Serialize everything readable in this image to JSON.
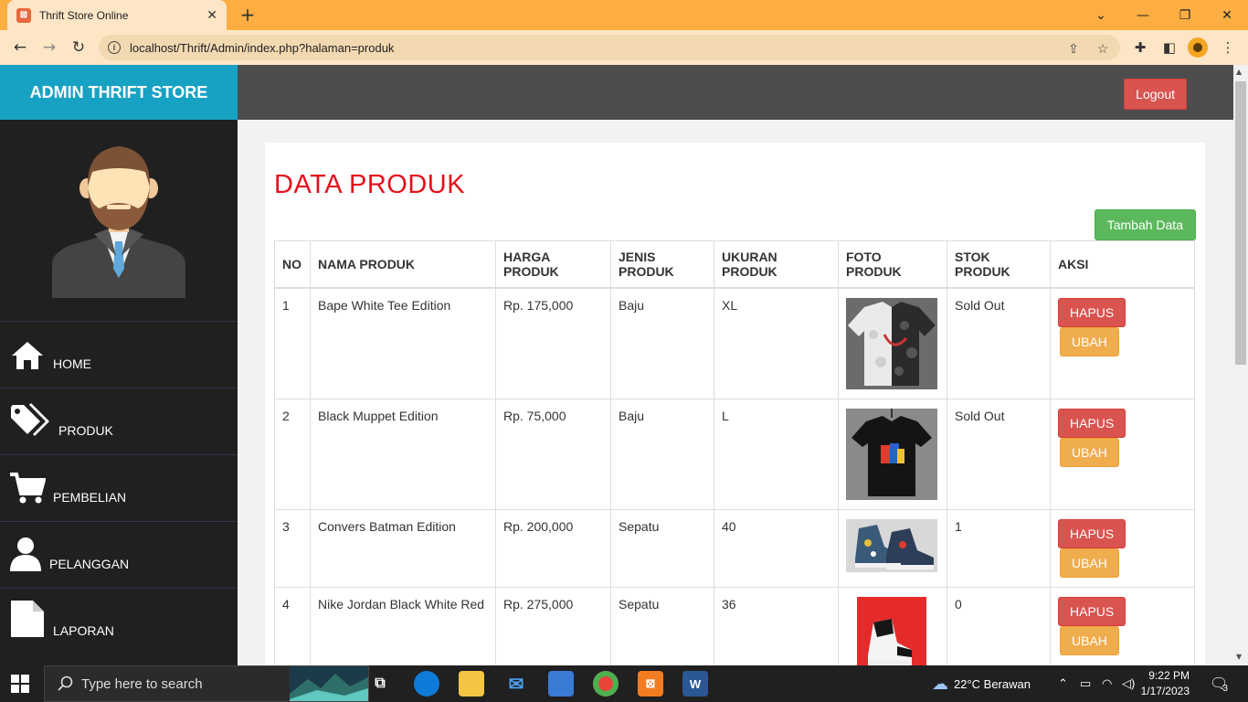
{
  "browser": {
    "tab_title": "Thrift Store Online",
    "url": "localhost/Thrift/Admin/index.php?halaman=produk"
  },
  "header": {
    "brand": "ADMIN THRIFT STORE",
    "logout_label": "Logout"
  },
  "sidebar": {
    "items": [
      {
        "label": "HOME",
        "icon": "home-icon"
      },
      {
        "label": "PRODUK",
        "icon": "tags-icon"
      },
      {
        "label": "PEMBELIAN",
        "icon": "cart-icon"
      },
      {
        "label": "PELANGGAN",
        "icon": "user-icon"
      },
      {
        "label": "LAPORAN",
        "icon": "file-icon"
      }
    ]
  },
  "main": {
    "title": "DATA PRODUK",
    "add_label": "Tambah Data",
    "columns": [
      "NO",
      "NAMA PRODUK",
      "HARGA PRODUK",
      "JENIS PRODUK",
      "UKURAN PRODUK",
      "FOTO PRODUK",
      "STOK PRODUK",
      "AKSI"
    ],
    "delete_label": "HAPUS",
    "edit_label": "UBAH",
    "rows": [
      {
        "no": "1",
        "nama": "Bape White Tee Edition",
        "harga": "Rp. 175,000",
        "jenis": "Baju",
        "ukuran": "XL",
        "stok": "Sold Out"
      },
      {
        "no": "2",
        "nama": "Black Muppet Edition",
        "harga": "Rp. 75,000",
        "jenis": "Baju",
        "ukuran": "L",
        "stok": "Sold Out"
      },
      {
        "no": "3",
        "nama": "Convers Batman Edition",
        "harga": "Rp. 200,000",
        "jenis": "Sepatu",
        "ukuran": "40",
        "stok": "1"
      },
      {
        "no": "4",
        "nama": "Nike Jordan Black White Red",
        "harga": "Rp. 275,000",
        "jenis": "Sepatu",
        "ukuran": "36",
        "stok": "0"
      }
    ]
  },
  "taskbar": {
    "search_placeholder": "Type here to search",
    "weather": "22°C  Berawan",
    "time": "9:22 PM",
    "date": "1/17/2023",
    "notifications": "3"
  },
  "colors": {
    "brand_bg": "#17a2c4",
    "heading": "#e4101c",
    "danger": "#d9534f",
    "warning": "#f0ad4e",
    "success": "#5cb85c"
  }
}
